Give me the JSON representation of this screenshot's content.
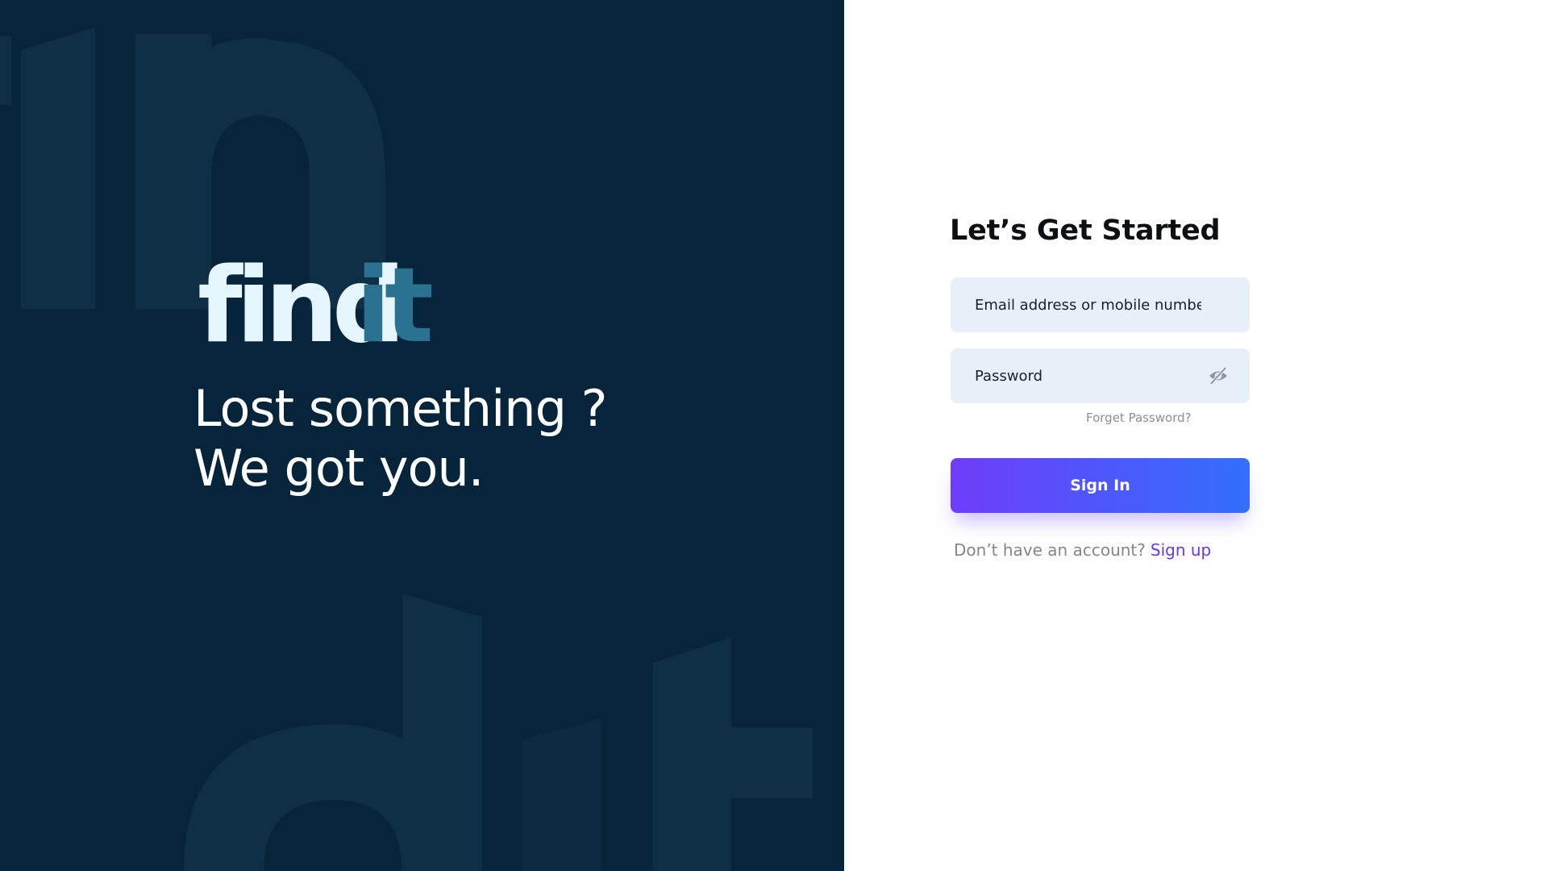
{
  "brand": {
    "logo_text": "findit",
    "colors": {
      "hero_bg": "#06253b",
      "logo_primary": "#e6f6ff",
      "logo_accent": "#2a7290",
      "button_gradient_start": "#6f3dfb",
      "button_gradient_end": "#336ffb",
      "link": "#6a34f5"
    }
  },
  "hero": {
    "tagline_line1": "Lost something ?",
    "tagline_line2": "We got you."
  },
  "form": {
    "title": "Let’s Get Started",
    "email_placeholder": "Email address or mobile number",
    "email_value": "",
    "password_placeholder": "Password",
    "password_value": "",
    "password_toggle_icon": "eye-slash-icon",
    "forgot_password": "Forget Password?",
    "sign_in_label": "Sign In",
    "no_account_text": "Don’t have an account?",
    "sign_up_label": "Sign up"
  }
}
